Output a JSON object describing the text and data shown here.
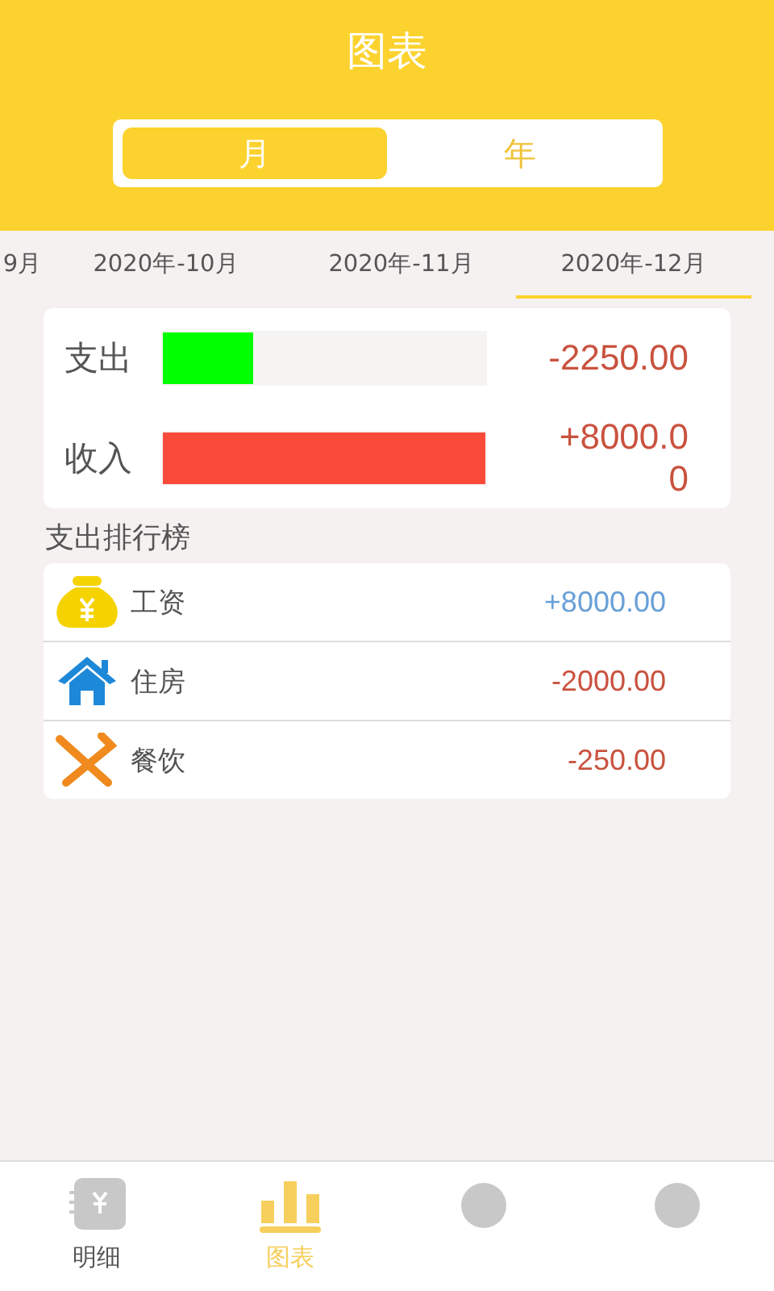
{
  "title": "图表",
  "segments": [
    {
      "label": "月",
      "selected": true
    },
    {
      "label": "年",
      "selected": false
    }
  ],
  "months": [
    {
      "label": "9月",
      "selected": false
    },
    {
      "label": "2020年-10月",
      "selected": false
    },
    {
      "label": "2020年-11月",
      "selected": false
    },
    {
      "label": "2020年-12月",
      "selected": true
    }
  ],
  "summary": [
    {
      "label": "支出",
      "level": 0.28,
      "amount": "-2250.00",
      "color": "#00ff00"
    },
    {
      "label": "收入",
      "level": 1,
      "amount": "+8000.00",
      "color": "#fa4b3a"
    }
  ],
  "ranking_title": "支出排行榜",
  "ranking": [
    {
      "kind": "salary",
      "name": "工资",
      "amount": "+8000.00",
      "color": "#6aa0d8"
    },
    {
      "kind": "housing",
      "name": "住房",
      "amount": "-2000.00",
      "color": "#c9523e"
    },
    {
      "kind": "dining",
      "name": "餐饮",
      "amount": "-250.00",
      "color": "#c9523e"
    }
  ],
  "nav": [
    {
      "kind": "notebook",
      "label": "明细",
      "selected": false
    },
    {
      "kind": "chart",
      "label": "图表",
      "selected": true
    },
    {
      "kind": "blank",
      "selected": false
    },
    {
      "kind": "blank",
      "selected": false
    }
  ]
}
